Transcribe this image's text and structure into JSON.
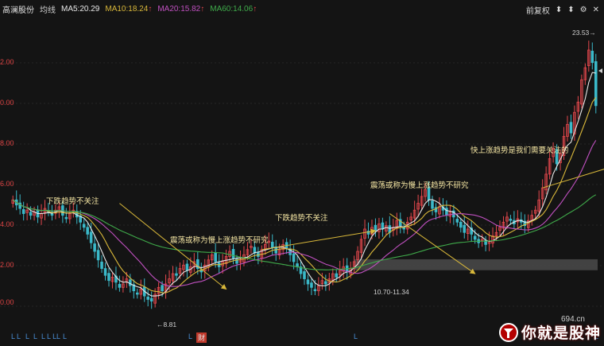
{
  "header": {
    "stock_name": "高澜股份",
    "ma_toggle": "均线",
    "ma5": "MA5:20.29",
    "ma10": "MA10:18.24",
    "ma20": "MA20:15.82",
    "ma60": "MA60:14.06",
    "ma_arrow": "↑"
  },
  "toolbar": {
    "adjust_label": "前复权",
    "tools": [
      "⬍",
      "⬍",
      "⚙",
      "✕"
    ]
  },
  "yaxis": {
    "labels": [
      "2.00",
      "0.00",
      "8.00",
      "6.00",
      "4.00",
      "2.00",
      "0.00"
    ]
  },
  "annotations": {
    "peak_price": "23.53",
    "low_price": "8.81",
    "range_label": "10.70-11.34",
    "note1": "下跌趋势不关注",
    "note2": "震荡或称为慢上涨趋势不研究",
    "note3": "下跌趋势不关注",
    "note4": "震荡或称为慢上涨趋势不研究",
    "note5": "快上涨趋势是我们需要关注的"
  },
  "bottom_marks": [
    "L",
    "L",
    "L",
    "L",
    "L",
    "L L",
    "L",
    "L",
    "L",
    "财",
    "L",
    "L"
  ],
  "watermark": {
    "site": "694.cn",
    "text": "你就是股神"
  },
  "colors": {
    "up": "#e5484d",
    "down": "#3bb9c9",
    "ma5": "#e8e8e8",
    "ma10": "#d9b83a",
    "ma20": "#c050c0",
    "ma60": "#3faa4a",
    "arrow": "#d9b83a",
    "band": "#4a4a4a"
  },
  "chart_data": {
    "type": "candlestick",
    "x": [
      0,
      1,
      2,
      3,
      4,
      5,
      6,
      7,
      8,
      9,
      10,
      11,
      12,
      13,
      14,
      15,
      16,
      17,
      18,
      19,
      20,
      21,
      22,
      23,
      24,
      25,
      26,
      27,
      28,
      29,
      30,
      31,
      32,
      33,
      34,
      35,
      36,
      37,
      38,
      39,
      40,
      41,
      42,
      43,
      44,
      45,
      46,
      47,
      48,
      49,
      50,
      51,
      52,
      53,
      54,
      55,
      56,
      57,
      58,
      59,
      60,
      61,
      62,
      63,
      64,
      65,
      66,
      67,
      68,
      69,
      70,
      71,
      72,
      73,
      74,
      75,
      76,
      77,
      78,
      79,
      80,
      81,
      82,
      83,
      84,
      85,
      86,
      87,
      88,
      89,
      90,
      91,
      92,
      93,
      94,
      95,
      96,
      97,
      98,
      99,
      100,
      101,
      102,
      103,
      104,
      105,
      106,
      107,
      108,
      109,
      110,
      111,
      112,
      113,
      114,
      115,
      116,
      117,
      118,
      119,
      120,
      121,
      122,
      123,
      124,
      125,
      126,
      127,
      128,
      129,
      130,
      131,
      132,
      133,
      134,
      135,
      136,
      137,
      138,
      139,
      140,
      141,
      142,
      143,
      144,
      145,
      146,
      147,
      148,
      149,
      150,
      151,
      152,
      153,
      154,
      155,
      156,
      157,
      158,
      159,
      160,
      161,
      162,
      163,
      164,
      165,
      166,
      167,
      168,
      169,
      170,
      171,
      172,
      173,
      174,
      175,
      176,
      177,
      178,
      179,
      180,
      181,
      182,
      183,
      184,
      185,
      186,
      187,
      188,
      189,
      190,
      191,
      192,
      193,
      194,
      195,
      196,
      197,
      198,
      199
    ],
    "close": [
      14.8,
      14.5,
      14.3,
      14.0,
      14.2,
      13.9,
      14.1,
      13.8,
      14.0,
      14.3,
      14.1,
      13.9,
      14.2,
      14.4,
      13.9,
      13.7,
      14.0,
      14.2,
      13.8,
      13.5,
      13.2,
      12.8,
      12.3,
      11.8,
      11.3,
      10.8,
      10.4,
      10.1,
      10.3,
      10.0,
      9.7,
      9.9,
      10.2,
      9.8,
      9.5,
      9.3,
      9.6,
      9.2,
      9.0,
      8.9,
      9.3,
      9.7,
      9.5,
      9.9,
      10.2,
      10.5,
      10.4,
      10.8,
      11.0,
      10.7,
      10.9,
      11.2,
      10.8,
      10.6,
      11.0,
      11.3,
      11.6,
      11.2,
      10.9,
      11.2,
      11.5,
      11.8,
      11.4,
      11.1,
      11.3,
      11.6,
      11.9,
      12.1,
      11.7,
      11.5,
      11.9,
      12.2,
      12.4,
      12.0,
      11.7,
      11.9,
      12.2,
      12.0,
      11.6,
      11.2,
      10.9,
      10.5,
      10.2,
      9.9,
      9.7,
      9.5,
      9.8,
      10.1,
      9.9,
      10.2,
      10.5,
      10.3,
      10.7,
      10.9,
      10.6,
      10.8,
      11.2,
      11.8,
      12.5,
      13.1,
      12.8,
      13.2,
      13.0,
      13.4,
      13.1,
      13.3,
      12.9,
      13.2,
      13.6,
      13.3,
      13.1,
      13.5,
      13.8,
      14.2,
      14.6,
      15.0,
      15.4,
      14.8,
      14.3,
      14.1,
      14.4,
      14.2,
      13.9,
      14.1,
      13.8,
      13.5,
      13.2,
      12.9,
      13.1,
      12.8,
      12.5,
      12.3,
      12.5,
      12.2,
      12.4,
      12.7,
      12.9,
      13.2,
      13.5,
      13.8,
      13.6,
      13.4,
      13.7,
      13.5,
      13.3,
      13.6,
      13.9,
      14.2,
      14.8,
      15.5,
      16.3,
      17.2,
      17.8,
      16.9,
      17.5,
      18.5,
      19.2,
      18.7,
      19.9,
      20.5,
      21.8,
      22.5,
      23.53,
      22.8,
      20.29
    ],
    "ma5_last": 20.29,
    "ma10_last": 18.24,
    "ma20_last": 15.82,
    "ma60_last": 14.06,
    "peak": 23.53,
    "low": 8.81,
    "support_band": [
      10.7,
      11.34
    ]
  }
}
